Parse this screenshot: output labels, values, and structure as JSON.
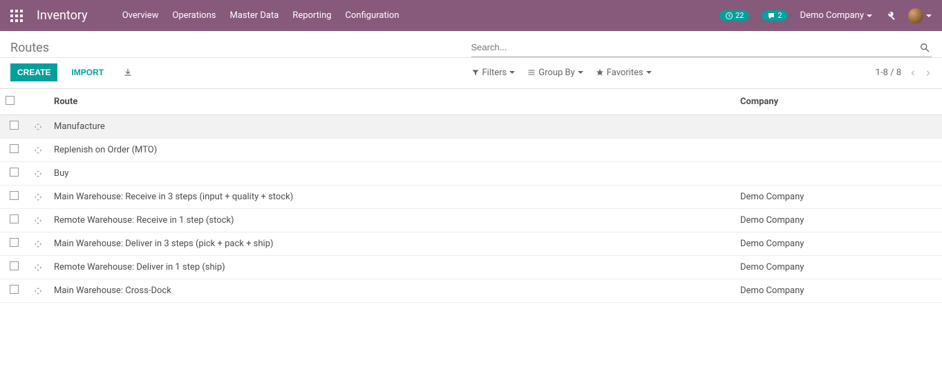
{
  "header": {
    "brand": "Inventory",
    "menu": [
      "Overview",
      "Operations",
      "Master Data",
      "Reporting",
      "Configuration"
    ],
    "activities_badge": "22",
    "messages_badge": "2",
    "company": "Demo Company"
  },
  "breadcrumb": "Routes",
  "search": {
    "placeholder": "Search..."
  },
  "buttons": {
    "create": "Create",
    "import": "Import"
  },
  "search_options": {
    "filters": "Filters",
    "group_by": "Group By",
    "favorites": "Favorites"
  },
  "pager": "1-8 / 8",
  "columns": {
    "route": "Route",
    "company": "Company"
  },
  "rows": [
    {
      "route": "Manufacture",
      "company": ""
    },
    {
      "route": "Replenish on Order (MTO)",
      "company": ""
    },
    {
      "route": "Buy",
      "company": ""
    },
    {
      "route": "Main Warehouse: Receive in 3 steps (input + quality + stock)",
      "company": "Demo Company"
    },
    {
      "route": "Remote Warehouse: Receive in 1 step (stock)",
      "company": "Demo Company"
    },
    {
      "route": "Main Warehouse: Deliver in 3 steps (pick + pack + ship)",
      "company": "Demo Company"
    },
    {
      "route": "Remote Warehouse: Deliver in 1 step (ship)",
      "company": "Demo Company"
    },
    {
      "route": "Main Warehouse: Cross-Dock",
      "company": "Demo Company"
    }
  ]
}
